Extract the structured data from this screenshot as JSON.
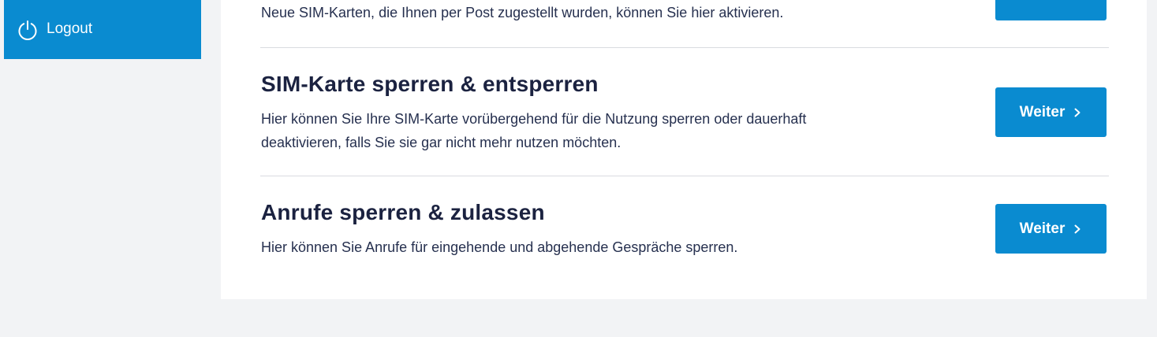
{
  "sidebar": {
    "logout": {
      "label": "Logout",
      "icon": "power-icon"
    }
  },
  "main": {
    "top_section": {
      "description": "Neue SIM-Karten, die Ihnen per Post zugestellt wurden, können Sie hier aktivieren."
    },
    "sections": [
      {
        "title": "SIM-Karte sperren & entsperren",
        "description": "Hier können Sie Ihre SIM-Karte vorübergehend für die Nutzung sperren oder dauerhaft deaktivieren, falls Sie sie gar nicht mehr nutzen möchten.",
        "button_label": "Weiter"
      },
      {
        "title": "Anrufe sperren & zulassen",
        "description": "Hier können Sie Anrufe für eingehende und abgehende Gespräche sperren.",
        "button_label": "Weiter"
      }
    ]
  },
  "colors": {
    "accent": "#0a8bd0",
    "heading": "#1b2240",
    "page_background": "#f2f3f5"
  }
}
